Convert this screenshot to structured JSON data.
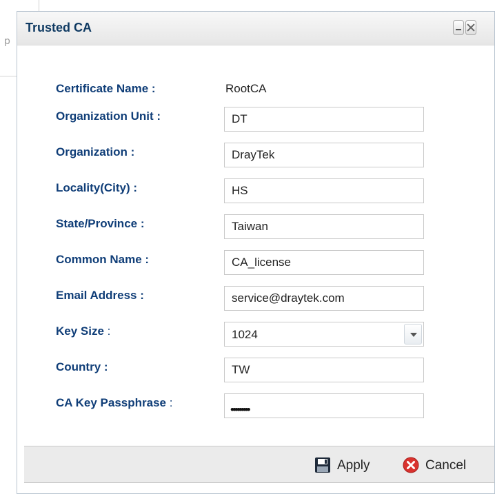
{
  "background": {
    "left_fragment": "p"
  },
  "dialog": {
    "title": "Trusted CA",
    "minimize_label": "",
    "close_label": ""
  },
  "form": {
    "certificate_name": {
      "label": "Certificate Name :",
      "value": "RootCA"
    },
    "organization_unit": {
      "label": "Organization Unit :",
      "value": "DT"
    },
    "organization": {
      "label": "Organization :",
      "value": "DrayTek"
    },
    "locality": {
      "label": "Locality(City) :",
      "value": "HS"
    },
    "state": {
      "label": "State/Province :",
      "value": "Taiwan"
    },
    "common_name": {
      "label": "Common Name :",
      "value": "CA_license"
    },
    "email": {
      "label": "Email Address :",
      "value": "service@draytek.com"
    },
    "key_size": {
      "label_bold": "Key Size",
      "label_rest": " :",
      "value": "1024"
    },
    "country": {
      "label": "Country :",
      "value": "TW"
    },
    "passphrase": {
      "label_bold": "CA Key Passphrase",
      "label_rest": " :",
      "masked": "•••••••••"
    }
  },
  "footer": {
    "apply_label": "Apply",
    "cancel_label": "Cancel"
  },
  "colors": {
    "label": "#103e78",
    "title": "#0f3a62",
    "cancel_icon": "#d9322e",
    "save_icon": "#1e2a3a"
  },
  "icons": {
    "apply": "save-disk-icon",
    "cancel": "cancel-circle-icon"
  }
}
